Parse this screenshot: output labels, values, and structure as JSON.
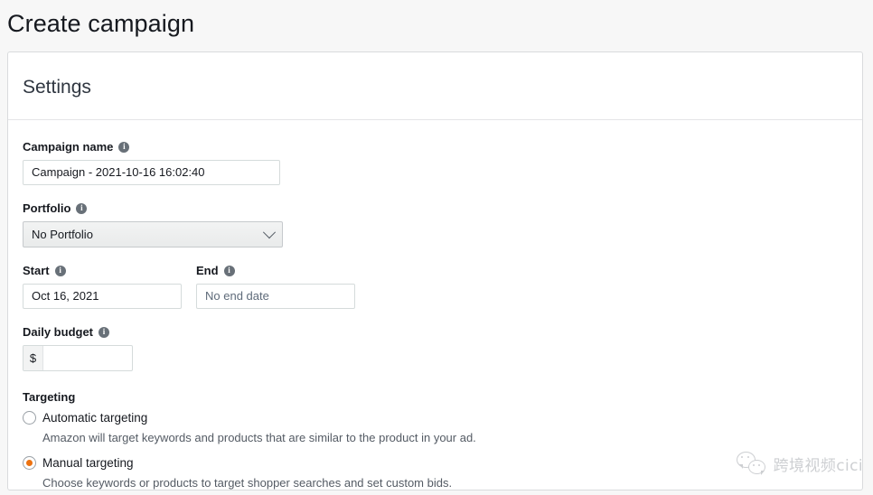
{
  "page": {
    "title": "Create campaign"
  },
  "card": {
    "header_title": "Settings"
  },
  "form": {
    "campaign_name": {
      "label": "Campaign name",
      "value": "Campaign - 2021-10-16 16:02:40",
      "info_icon": "info-icon"
    },
    "portfolio": {
      "label": "Portfolio",
      "selected": "No Portfolio",
      "info_icon": "info-icon",
      "chevron_icon": "chevron-down-icon"
    },
    "start": {
      "label": "Start",
      "value": "Oct 16, 2021",
      "info_icon": "info-icon"
    },
    "end": {
      "label": "End",
      "value": "No end date",
      "info_icon": "info-icon"
    },
    "daily_budget": {
      "label": "Daily budget",
      "currency_symbol": "$",
      "value": "",
      "placeholder": "",
      "info_icon": "info-icon"
    },
    "targeting": {
      "title": "Targeting",
      "options": [
        {
          "label": "Automatic targeting",
          "description": "Amazon will target keywords and products that are similar to the product in your ad.",
          "selected": false
        },
        {
          "label": "Manual targeting",
          "description": "Choose keywords or products to target shopper searches and set custom bids.",
          "selected": true
        }
      ]
    }
  },
  "watermark": {
    "logo_icon": "wechat-logo-icon",
    "text": "跨境视频cici"
  },
  "colors": {
    "accent": "#ec7211",
    "page_background": "#f7f7f7",
    "card_background": "#ffffff",
    "border": "#d9dbdd",
    "text_primary": "#16191f",
    "text_secondary": "#545b64"
  }
}
